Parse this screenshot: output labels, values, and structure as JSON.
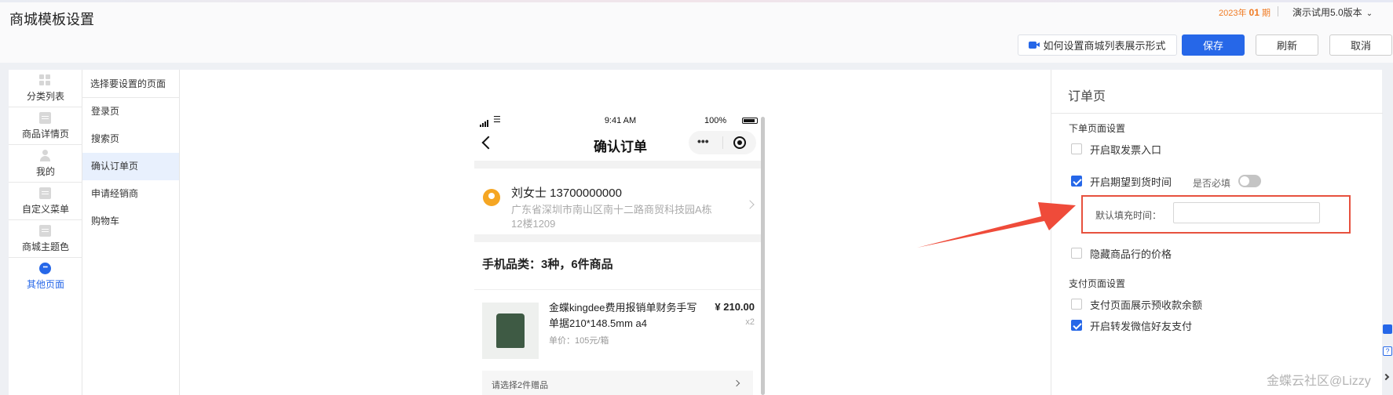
{
  "header": {
    "title": "商城模板设置",
    "period_prefix": "2023年",
    "period_number": "01",
    "period_suffix": "期",
    "version": "演示试用5.0版本",
    "help_label": "如何设置商城列表展示形式",
    "save_label": "保存",
    "refresh_label": "刷新",
    "cancel_label": "取消"
  },
  "icon_nav": [
    {
      "label": "分类列表",
      "icon": "grid-icon"
    },
    {
      "label": "商品详情页",
      "icon": "document-icon"
    },
    {
      "label": "我的",
      "icon": "user-icon"
    },
    {
      "label": "自定义菜单",
      "icon": "document-icon"
    },
    {
      "label": "商城主题色",
      "icon": "document-icon"
    },
    {
      "label": "其他页面",
      "icon": "more-icon",
      "active": true
    }
  ],
  "page_list": {
    "header": "选择要设置的页面",
    "items": [
      "登录页",
      "搜索页",
      "确认订单页",
      "申请经销商",
      "购物车"
    ],
    "selected": "确认订单页"
  },
  "preview": {
    "time": "9:41 AM",
    "battery": "100%",
    "title": "确认订单",
    "address_name": "刘女士 13700000000",
    "address_detail": "广东省深圳市南山区南十二路商贸科技园A栋12楼1209",
    "category_summary": "手机品类：3种，6件商品",
    "product_name": "金蝶kingdee费用报销单财务手写单据210*148.5mm   a4",
    "product_unit_price": "单价：105元/箱",
    "product_price": "¥ 210.00",
    "product_qty": "x2",
    "gift_prompt": "请选择2件赠品"
  },
  "settings": {
    "title": "订单页",
    "order_section": "下单页面设置",
    "invoice_entry": {
      "label": "开启取发票入口",
      "checked": false
    },
    "expected_delivery": {
      "label": "开启期望到货时间",
      "checked": true
    },
    "required_label": "是否必填",
    "required_toggle_on": false,
    "default_fill_label": "默认填充时间：",
    "default_fill_value": "",
    "hide_price": {
      "label": "隐藏商品行的价格",
      "checked": false
    },
    "payment_section": "支付页面设置",
    "show_prepaid": {
      "label": "支付页面展示预收款余额",
      "checked": false
    },
    "wechat_pay": {
      "label": "开启转发微信好友支付",
      "checked": true
    }
  },
  "watermark": "金蝶云社区@Lizzy",
  "colors": {
    "accent": "#2667e8",
    "annotation": "#e7513e",
    "period": "#f07a22"
  }
}
